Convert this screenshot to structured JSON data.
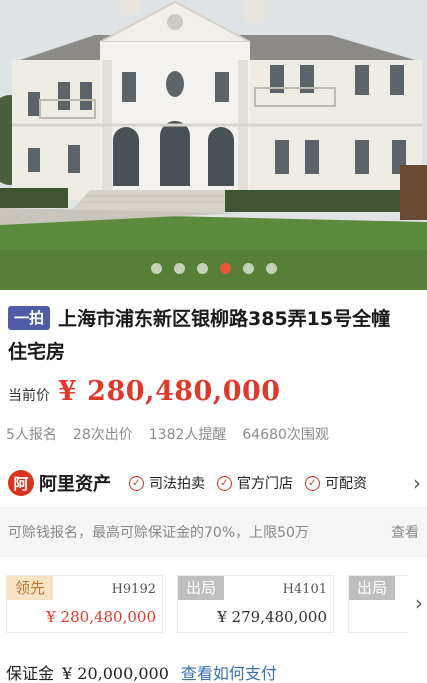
{
  "carousel": {
    "total": 6,
    "active_index": 3
  },
  "listing": {
    "tag": "一拍",
    "title_line1": "上海市浦东新区银柳路385弄15号全幢",
    "title_line2": "住宅房",
    "price_label": "当前价",
    "price": "¥ 280,480,000",
    "stats": [
      "5人报名",
      "28次出价",
      "1382人提醒",
      "64680次围观"
    ]
  },
  "services": {
    "logo_mark": "阿",
    "logo_name": "阿里资产",
    "items": [
      "司法拍卖",
      "官方门店",
      "可配资"
    ]
  },
  "notice": {
    "text": "可赊钱报名，最高可赊保证金的70%，上限50万",
    "link": "查看"
  },
  "bids": [
    {
      "badge": "领先",
      "code": "H9192",
      "amount": "¥ 280,480,000",
      "state": "lead"
    },
    {
      "badge": "出局",
      "code": "H4101",
      "amount": "¥ 279,480,000",
      "state": "out"
    },
    {
      "badge": "出局",
      "code": "",
      "amount": "",
      "state": "out"
    }
  ],
  "deposit": {
    "label": "保证金",
    "value": "¥ 20,000,000",
    "link": "查看如何支付"
  },
  "colors": {
    "accent": "#e0392b",
    "tag": "#4f5da8",
    "link": "#3a6fb0"
  }
}
